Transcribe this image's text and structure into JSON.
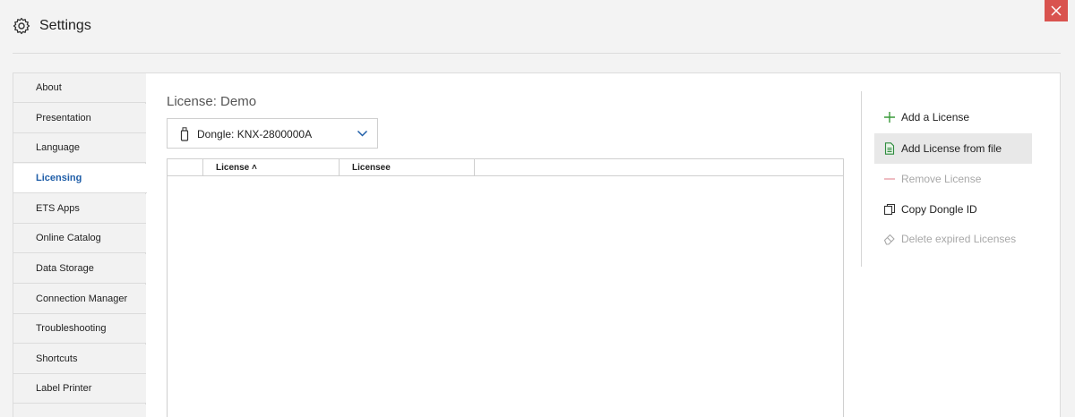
{
  "window": {
    "title": "Settings",
    "icon": "gear-icon",
    "close_icon": "close-icon"
  },
  "sidebar": {
    "items": [
      {
        "label": "About",
        "active": false
      },
      {
        "label": "Presentation",
        "active": false
      },
      {
        "label": "Language",
        "active": false
      },
      {
        "label": "Licensing",
        "active": true
      },
      {
        "label": "ETS Apps",
        "active": false
      },
      {
        "label": "Online Catalog",
        "active": false
      },
      {
        "label": "Data Storage",
        "active": false
      },
      {
        "label": "Connection Manager",
        "active": false
      },
      {
        "label": "Troubleshooting",
        "active": false
      },
      {
        "label": "Shortcuts",
        "active": false
      },
      {
        "label": "Label Printer",
        "active": false
      },
      {
        "label": "",
        "active": false
      }
    ]
  },
  "main": {
    "heading": "License: Demo",
    "dongle": {
      "selected": "Dongle: KNX-2800000A",
      "icon": "usb-dongle-icon"
    },
    "grid": {
      "columns": [
        "",
        "License ˄",
        "Licensee",
        ""
      ],
      "rows": []
    }
  },
  "actions": [
    {
      "label": "Add a License",
      "icon": "plus-icon",
      "enabled": true
    },
    {
      "label": "Add License from file",
      "icon": "file-icon",
      "enabled": true
    },
    {
      "label": "Remove License",
      "icon": "minus-icon",
      "enabled": false
    },
    {
      "label": "Copy Dongle ID",
      "icon": "copy-icon",
      "enabled": true
    },
    {
      "label": "Delete expired Licenses",
      "icon": "eraser-icon",
      "enabled": false
    }
  ],
  "colors": {
    "accent": "#1f5ea8",
    "close_button": "#d9534f",
    "plus_green": "#3a9a3a",
    "file_green": "#2e8b3e",
    "minus_red": "#e8a0a8"
  }
}
